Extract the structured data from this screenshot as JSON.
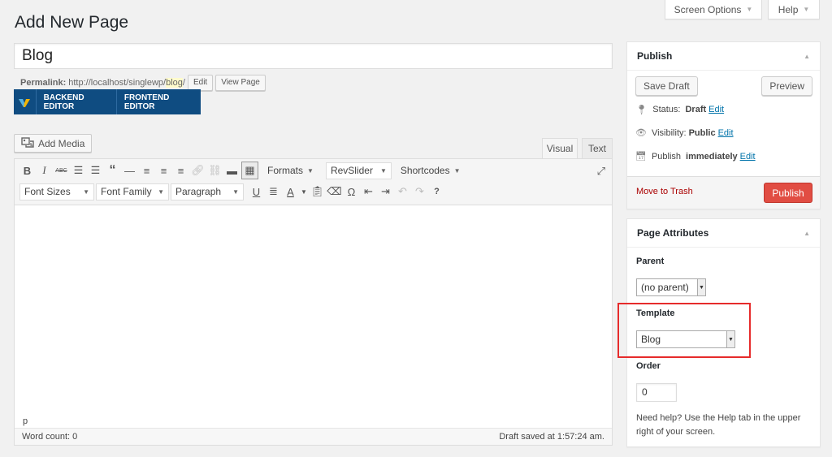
{
  "screen_options": {
    "label": "Screen Options"
  },
  "help_tab": {
    "label": "Help"
  },
  "page_title": "Add New Page",
  "post_title": "Blog",
  "permalink": {
    "label": "Permalink:",
    "url_base": "http://localhost/singlewp/",
    "slug": "blog",
    "trailing": "/",
    "edit_label": "Edit",
    "view_label": "View Page"
  },
  "vc": {
    "backend_label": "BACKEND EDITOR",
    "frontend_label": "FRONTEND EDITOR"
  },
  "add_media_label": "Add Media",
  "editor_tabs": {
    "visual": "Visual",
    "text": "Text"
  },
  "toolbar": {
    "formats": "Formats",
    "revslider": "RevSlider",
    "shortcodes": "Shortcodes",
    "font_sizes": "Font Sizes",
    "font_family": "Font Family",
    "paragraph": "Paragraph"
  },
  "editor_status": {
    "path": "p",
    "word_count": "Word count: 0",
    "draft_saved": "Draft saved at 1:57:24 am."
  },
  "publish_box": {
    "title": "Publish",
    "save_draft": "Save Draft",
    "preview": "Preview",
    "status_label": "Status:",
    "status_value": "Draft",
    "visibility_label": "Visibility:",
    "visibility_value": "Public",
    "publish_label": "Publish",
    "publish_value": "immediately",
    "edit_link": "Edit",
    "move_to_trash": "Move to Trash",
    "publish_button": "Publish"
  },
  "page_attributes": {
    "title": "Page Attributes",
    "parent_label": "Parent",
    "parent_value": "(no parent)",
    "template_label": "Template",
    "template_value": "Blog",
    "order_label": "Order",
    "order_value": "0",
    "help_text": "Need help? Use the Help tab in the upper right of your screen."
  },
  "colors": {
    "accent_link": "#0073aa",
    "publish_button": "#e14d43",
    "vc_bar": "#0f4c81",
    "highlight_box": "#e62b2b"
  }
}
